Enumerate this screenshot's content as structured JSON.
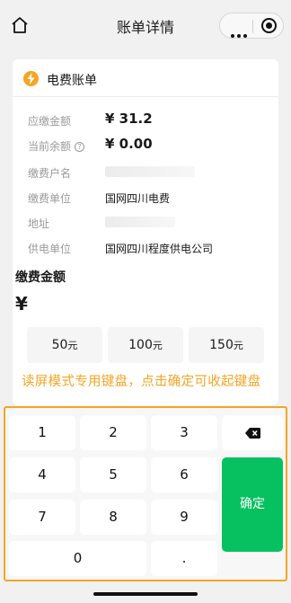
{
  "nav": {
    "title": "账单详情"
  },
  "bill": {
    "title": "电费账单",
    "rows": {
      "payable_label": "应缴金额",
      "payable_value": "¥ 31.2",
      "balance_label": "当前余额",
      "balance_value": "¥ 0.00",
      "account_label": "缴费户名",
      "unit_label": "缴费单位",
      "unit_value": "国网四川电费",
      "address_label": "地址",
      "supplier_label": "供电单位",
      "supplier_value": "国网四川程度供电公司"
    },
    "amount_label": "缴费金额",
    "currency": "¥",
    "quick_amounts": [
      {
        "value": "50",
        "unit": "元"
      },
      {
        "value": "100",
        "unit": "元"
      },
      {
        "value": "150",
        "unit": "元"
      }
    ],
    "notice": "读屏模式专用键盘，点击确定可收起键盘"
  },
  "keyboard": {
    "keys": [
      "1",
      "2",
      "3",
      "4",
      "5",
      "6",
      "7",
      "8",
      "9",
      "0",
      "."
    ],
    "confirm": "确定",
    "delete_icon": "backspace-icon"
  },
  "colors": {
    "accent": "#f5a524",
    "confirm": "#07c160"
  }
}
